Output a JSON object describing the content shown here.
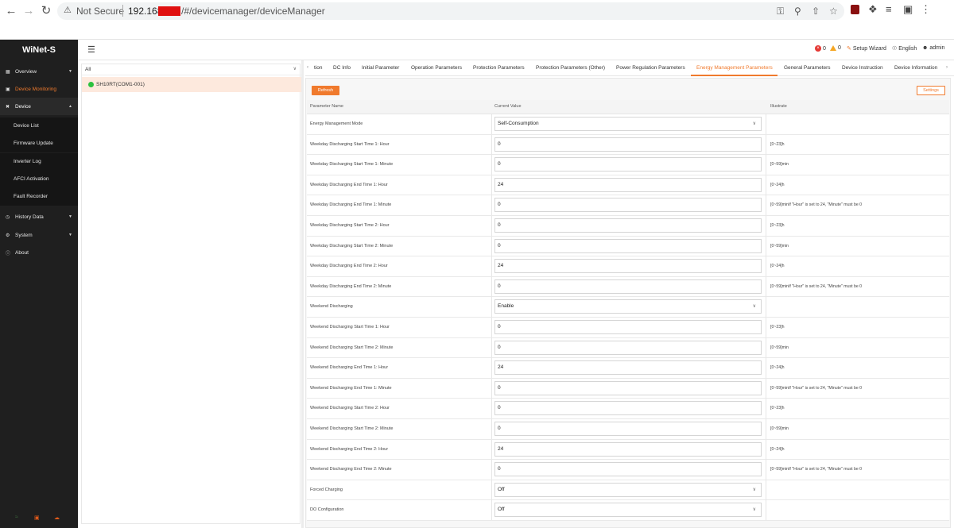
{
  "browser": {
    "security_label": "Not Secure",
    "host": "192.168.",
    "path": "/#/devicemanager/deviceManager"
  },
  "app": {
    "brand": "WiNet-S",
    "alerts": {
      "errors": "0",
      "warnings": "0"
    },
    "setup_wizard": "Setup Wizard",
    "language": "English",
    "user": "admin"
  },
  "sidebar": {
    "overview": "Overview",
    "device_monitoring": "Device Monitoring",
    "device": "Device",
    "device_sub": [
      "Device List",
      "Firmware Update",
      "Inverter Log",
      "AFCI Activation",
      "Fault Recorder"
    ],
    "history_data": "History Data",
    "system": "System",
    "about": "About"
  },
  "tree": {
    "filter_value": "All",
    "node": "SH10RT(COM1-001)"
  },
  "tabs": [
    "tion",
    "DC Info",
    "Initial Parameter",
    "Operation Parameters",
    "Protection Parameters",
    "Protection Parameters (Other)",
    "Power Regulation Parameters",
    "Energy Management Parameters",
    "General Parameters",
    "Device Instruction",
    "Device Information"
  ],
  "toolbar": {
    "refresh": "Refresh",
    "settings": "Settings"
  },
  "table": {
    "headers": {
      "name": "Parameter Name",
      "value": "Current Value",
      "illustrate": "Illustrate"
    },
    "rows": [
      {
        "name": "Energy Management Mode",
        "value": "Self-Consumption",
        "select": true,
        "illus": ""
      },
      {
        "name": "Weekday Discharging Start Time 1: Hour",
        "value": "0",
        "select": false,
        "illus": "[0~23]h"
      },
      {
        "name": "Weekday Discharging Start Time 1: Minute",
        "value": "0",
        "select": false,
        "illus": "[0~59]min"
      },
      {
        "name": "Weekday Discharging End Time 1: Hour",
        "value": "24",
        "select": false,
        "illus": "[0~24]h"
      },
      {
        "name": "Weekday Discharging End Time 1: Minute",
        "value": "0",
        "select": false,
        "illus": "[0~59]minIf \"Hour\" is set to 24, \"Minute\" must be 0"
      },
      {
        "name": "Weekday Discharging Start Time 2: Hour",
        "value": "0",
        "select": false,
        "illus": "[0~23]h"
      },
      {
        "name": "Weekday Discharging Start Time 2: Minute",
        "value": "0",
        "select": false,
        "illus": "[0~59]min"
      },
      {
        "name": "Weekday Discharging End Time 2: Hour",
        "value": "24",
        "select": false,
        "illus": "[0~24]h"
      },
      {
        "name": "Weekday Discharging End Time 2: Minute",
        "value": "0",
        "select": false,
        "illus": "[0~59]minIf \"Hour\" is set to 24, \"Minute\" must be 0"
      },
      {
        "name": "Weekend Discharging",
        "value": "Enable",
        "select": true,
        "illus": ""
      },
      {
        "name": "Weekend Discharging Start Time 1: Hour",
        "value": "0",
        "select": false,
        "illus": "[0~23]h"
      },
      {
        "name": "Weekend Discharging Start Time 2: Minute",
        "value": "0",
        "select": false,
        "illus": "[0~59]min"
      },
      {
        "name": "Weekend Discharging End Time 1: Hour",
        "value": "24",
        "select": false,
        "illus": "[0~24]h"
      },
      {
        "name": "Weekend Discharging End Time 1: Minute",
        "value": "0",
        "select": false,
        "illus": "[0~59]minIf \"Hour\" is set to 24, \"Minute\" must be 0"
      },
      {
        "name": "Weekend Discharging Start Time 2: Hour",
        "value": "0",
        "select": false,
        "illus": "[0~23]h"
      },
      {
        "name": "Weekend Discharging Start Time 2: Minute",
        "value": "0",
        "select": false,
        "illus": "[0~59]min"
      },
      {
        "name": "Weekend Discharging End Time 2: Hour",
        "value": "24",
        "select": false,
        "illus": "[0~24]h"
      },
      {
        "name": "Weekend Discharging End Time 2: Minute",
        "value": "0",
        "select": false,
        "illus": "[0~59]minIf \"Hour\" is set to 24, \"Minute\" must be 0"
      },
      {
        "name": "Forced Charging",
        "value": "Off",
        "select": true,
        "illus": ""
      },
      {
        "name": "DO Configuration",
        "value": "Off",
        "select": true,
        "illus": ""
      }
    ]
  },
  "colors": {
    "accent": "#f07a2d",
    "sidebar_bg": "#1f1f1f",
    "selected_node": "#fde9dd",
    "online": "#2cc13e"
  }
}
